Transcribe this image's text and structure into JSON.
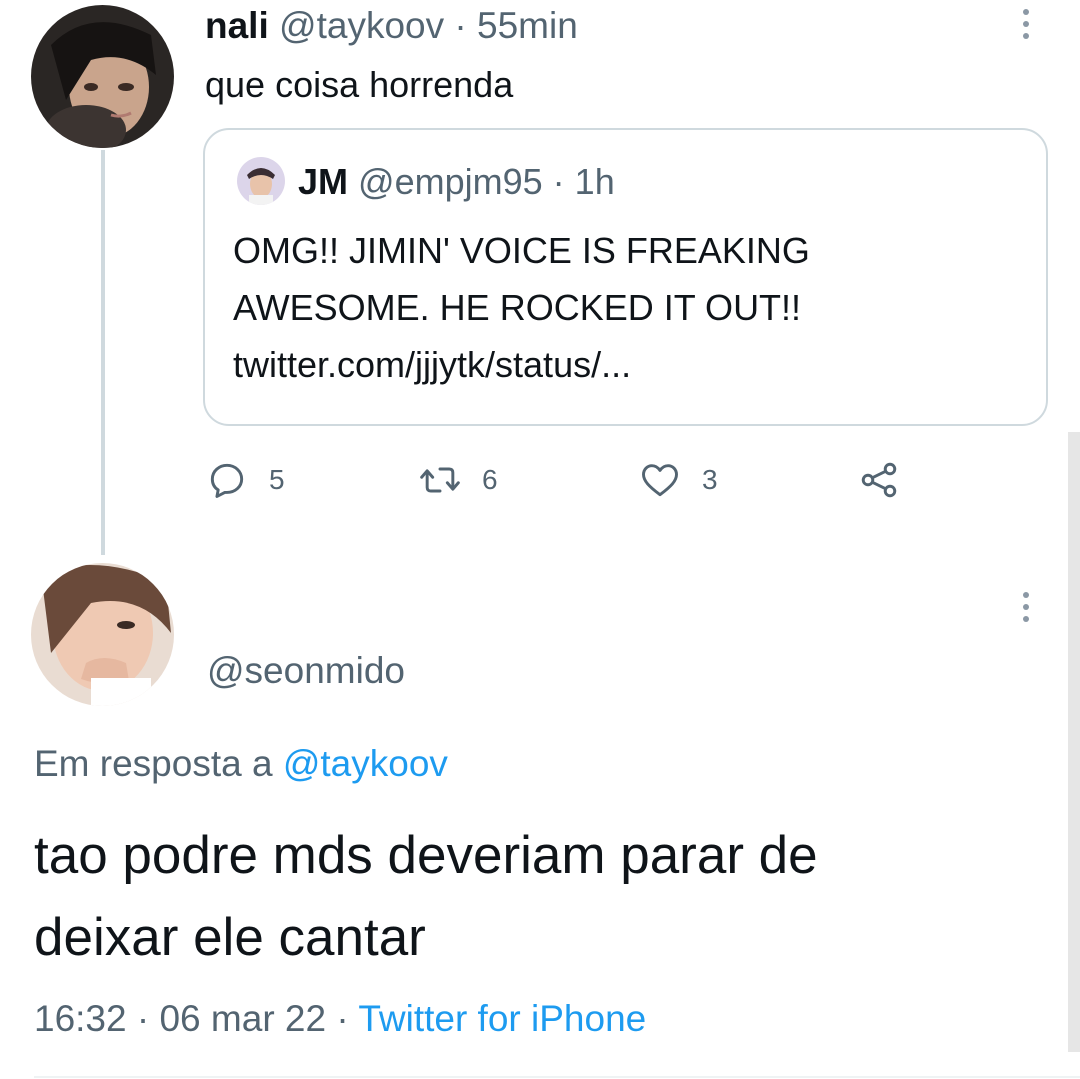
{
  "tweet1": {
    "name": "nali",
    "handle": "@taykoov",
    "sep": "·",
    "time": "55min",
    "text": "que coisa horrenda",
    "avatar_icon": "profile-photo-icon",
    "quote": {
      "name": "JM",
      "handle": "@empjm95",
      "sep": "·",
      "time": "1h",
      "lines": [
        "OMG!! JIMIN' VOICE IS FREAKING",
        "AWESOME. HE ROCKED IT OUT!!",
        "twitter.com/jjjytk/status/..."
      ]
    },
    "actions": {
      "replies": "5",
      "retweets": "6",
      "likes": "3"
    }
  },
  "tweet2": {
    "handle": "@seonmido",
    "reply_prefix": "Em resposta a",
    "reply_handle": "@taykoov",
    "text_line1": "tao podre mds deveriam parar de",
    "text_line2": "deixar ele cantar",
    "time": "16:32",
    "sep": "·",
    "date": "06 mar 22",
    "sep2": "·",
    "source": "Twitter for iPhone"
  },
  "colors": {
    "text": "#0f1419",
    "muted": "#536471",
    "link": "#1d9bf0",
    "border": "#cfd9de"
  }
}
